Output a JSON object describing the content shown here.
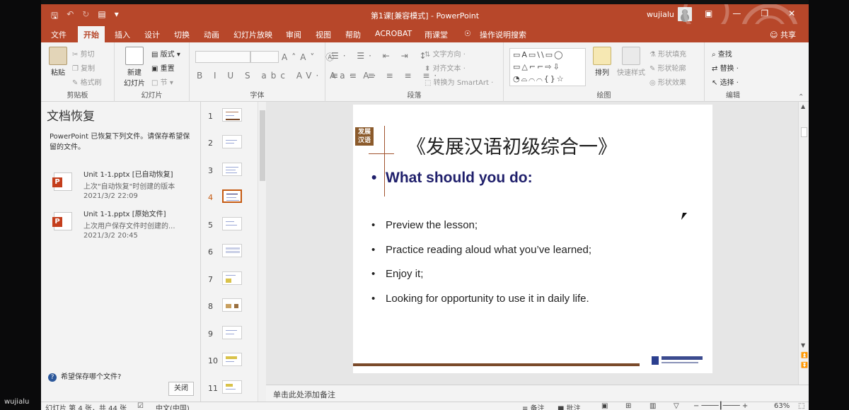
{
  "host_label": "wujialu",
  "titlebar": {
    "title": "第1课[兼容模式] - PowerPoint",
    "user": "wujialu",
    "qat_icons": [
      "save-icon",
      "undo-icon",
      "redo-icon",
      "start-from-beginning-icon",
      "customize-qat-icon"
    ],
    "window_buttons": [
      "ribbon-display-options-icon",
      "minimize-icon",
      "restore-icon",
      "close-icon"
    ]
  },
  "tabs": [
    {
      "label": "文件"
    },
    {
      "label": "开始",
      "active": true
    },
    {
      "label": "插入"
    },
    {
      "label": "设计"
    },
    {
      "label": "切换"
    },
    {
      "label": "动画"
    },
    {
      "label": "幻灯片放映"
    },
    {
      "label": "审阅"
    },
    {
      "label": "视图"
    },
    {
      "label": "帮助"
    },
    {
      "label": "ACROBAT"
    },
    {
      "label": "雨课堂"
    },
    {
      "label": "操作说明搜索"
    }
  ],
  "share_label": "共享",
  "ribbon": {
    "clipboard": {
      "label": "剪贴板",
      "paste": "粘贴",
      "cut": "剪切",
      "copy": "复制",
      "format_painter": "格式刷"
    },
    "slides": {
      "label": "幻灯片",
      "new_slide_line1": "新建",
      "new_slide_line2": "幻灯片",
      "layout": "版式",
      "reset": "重置",
      "section": "节"
    },
    "font": {
      "label": "字体"
    },
    "paragraph": {
      "label": "段落",
      "text_direction": "文字方向",
      "align_text": "对齐文本",
      "smartart": "转换为 SmartArt"
    },
    "drawing": {
      "label": "绘图",
      "arrange": "排列",
      "quick_styles": "快速样式",
      "shape_fill": "形状填充",
      "shape_outline": "形状轮廓",
      "shape_effects": "形状效果"
    },
    "editing": {
      "label": "编辑",
      "find": "查找",
      "replace": "替换",
      "select": "选择"
    }
  },
  "recovery": {
    "title": "文档恢复",
    "description": "PowerPoint 已恢复下列文件。请保存希望保留的文件。",
    "files": [
      {
        "name": "Unit 1-1.pptx  [已自动恢复]",
        "desc": "上次\"自动恢复\"时创建的版本",
        "date": "2021/3/2 22:09"
      },
      {
        "name": "Unit 1-1.pptx  [原始文件]",
        "desc": "上次用户保存文件时创建的...",
        "date": "2021/3/2 20:45"
      }
    ],
    "help_link": "希望保存哪个文件?",
    "close_button": "关闭"
  },
  "thumbnails": [
    "1",
    "2",
    "3",
    "4",
    "5",
    "6",
    "7",
    "8",
    "9",
    "10",
    "11"
  ],
  "selected_slide": "4",
  "slide": {
    "badge_line1": "发展",
    "badge_line2": "汉语",
    "title": "《发展汉语初级综合一》",
    "heading": "What should you do:",
    "bullets": [
      "Preview the lesson;",
      "Practice reading aloud what you’ve learned;",
      "Enjoy it;",
      "Looking for opportunity to use it in daily life."
    ]
  },
  "notes_placeholder": "单击此处添加备注",
  "statusbar": {
    "slide_info": "幻灯片 第 4 张，共 44 张",
    "language": "中文(中国)",
    "notes": "备注",
    "comments": "批注",
    "zoom": "63%"
  },
  "colors": {
    "accent": "#b7472a",
    "slide_heading": "#1f1f6b",
    "brown": "#7a4a2a"
  }
}
